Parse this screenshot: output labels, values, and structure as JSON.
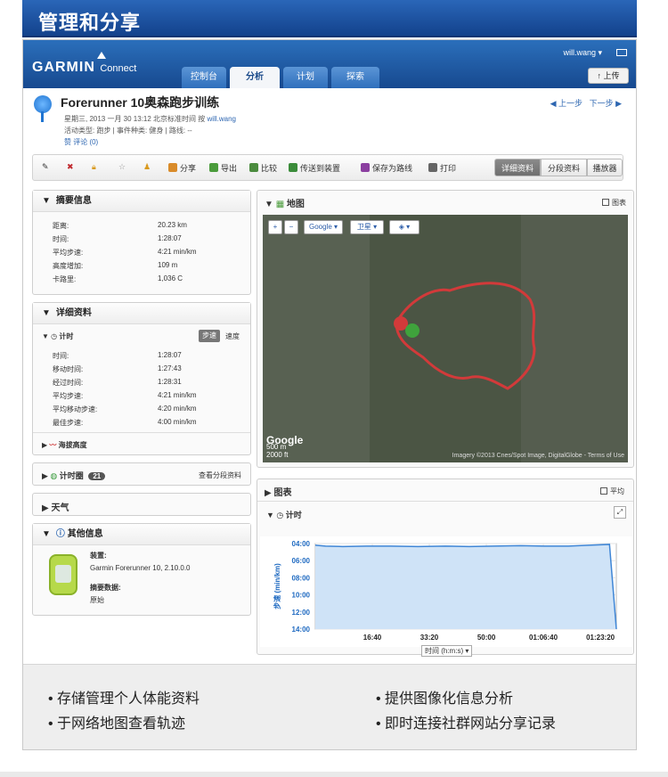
{
  "banner": {
    "title": "管理和分享"
  },
  "header": {
    "brand": "GARMIN",
    "brand_sub": "Connect",
    "tabs": [
      {
        "label": "控制台"
      },
      {
        "label": "分析"
      },
      {
        "label": "计划"
      },
      {
        "label": "探索"
      }
    ],
    "user": "will.wang ▾",
    "upload": "上传"
  },
  "activity": {
    "title": "Forerunner 10奥森跑步训练",
    "meta_date": "星期三, 2013 一月 30 13:12 北京标准时间 按",
    "meta_user": "will.wang",
    "meta_type": "活动类型: 跑步 | 事件种类: 健身 | 路线: --",
    "meta_like": "赞  评论 (0)",
    "prev": "上一步",
    "next": "下一步"
  },
  "toolbar": {
    "share": "分享",
    "export": "导出",
    "compare": "比较",
    "send": "传送到装置",
    "save_course": "保存为路线",
    "print": "打印",
    "views": [
      "详细资料",
      "分段资料",
      "播放器"
    ]
  },
  "summary": {
    "title": "摘要信息",
    "rows": [
      {
        "k": "距离:",
        "v": "20.23 km"
      },
      {
        "k": "时间:",
        "v": "1:28:07"
      },
      {
        "k": "平均步速:",
        "v": "4:21 min/km"
      },
      {
        "k": "高度增加:",
        "v": "109 m"
      },
      {
        "k": "卡路里:",
        "v": "1,036 C"
      }
    ]
  },
  "details": {
    "title": "详细资料",
    "timing_title": "计时",
    "pace_btn": "步速",
    "speed_btn": "速度",
    "rows": [
      {
        "k": "时间:",
        "v": "1:28:07"
      },
      {
        "k": "移动时间:",
        "v": "1:27:43"
      },
      {
        "k": "经过时间:",
        "v": "1:28:31"
      },
      {
        "k": "平均步速:",
        "v": "4:21 min/km"
      },
      {
        "k": "平均移动步速:",
        "v": "4:20 min/km"
      },
      {
        "k": "最佳步速:",
        "v": "4:00 min/km"
      }
    ],
    "elevation": "海拔高度"
  },
  "laps": {
    "title": "计时圈",
    "count": "21",
    "link": "查看分段资料"
  },
  "weather": {
    "title": "天气"
  },
  "other": {
    "title": "其他信息",
    "device_label": "装置:",
    "device": "Garmin Forerunner 10, 2.10.0.0",
    "summary_label": "摘要数据:",
    "summary_value": "原始"
  },
  "map": {
    "title": "地图",
    "legend": "图表",
    "provider": "Google",
    "layer": "卫星",
    "scale1": "500 m",
    "scale2": "2000 ft",
    "copyright": "Imagery ©2013 Cnes/Spot Image, DigitalGlobe - Terms of Use",
    "watermark": "Google"
  },
  "charts": {
    "title": "图表",
    "smooth": "平均",
    "timing_label": "计时",
    "xaxis_select": "时间 (h:m:s)"
  },
  "chart_data": {
    "type": "area",
    "xlabel": "时间 (h:m:s)",
    "ylabel": "步速 (min/km)",
    "x_ticks": [
      "16:40",
      "33:20",
      "50:00",
      "01:06:40",
      "01:23:20"
    ],
    "y_ticks": [
      "04:00",
      "06:00",
      "08:00",
      "10:00",
      "12:00",
      "14:00"
    ],
    "ylim_minutes": [
      4,
      14
    ],
    "x_minutes": [
      0,
      3,
      8,
      15,
      22,
      30,
      38,
      45,
      52,
      60,
      67,
      74,
      80,
      86,
      88
    ],
    "pace_minutes": [
      4.2,
      4.3,
      4.35,
      4.3,
      4.3,
      4.35,
      4.3,
      4.35,
      4.3,
      4.25,
      4.3,
      4.3,
      4.2,
      4.1,
      14
    ],
    "series": [
      {
        "values": [
          4.2,
          4.3,
          4.35,
          4.3,
          4.3,
          4.35,
          4.3,
          4.35,
          4.3,
          4.25,
          4.3,
          4.3,
          4.2,
          4.1,
          14
        ]
      }
    ],
    "colors": {
      "fill": "#cfe3f7",
      "line": "#3f86d6",
      "axis_text": "#1f6ac1"
    },
    "grid": true
  },
  "features": [
    "• 存储管理个人体能资料",
    "• 提供图像化信息分析",
    "• 于网络地图查看轨迹",
    "• 即时连接社群网站分享记录"
  ]
}
